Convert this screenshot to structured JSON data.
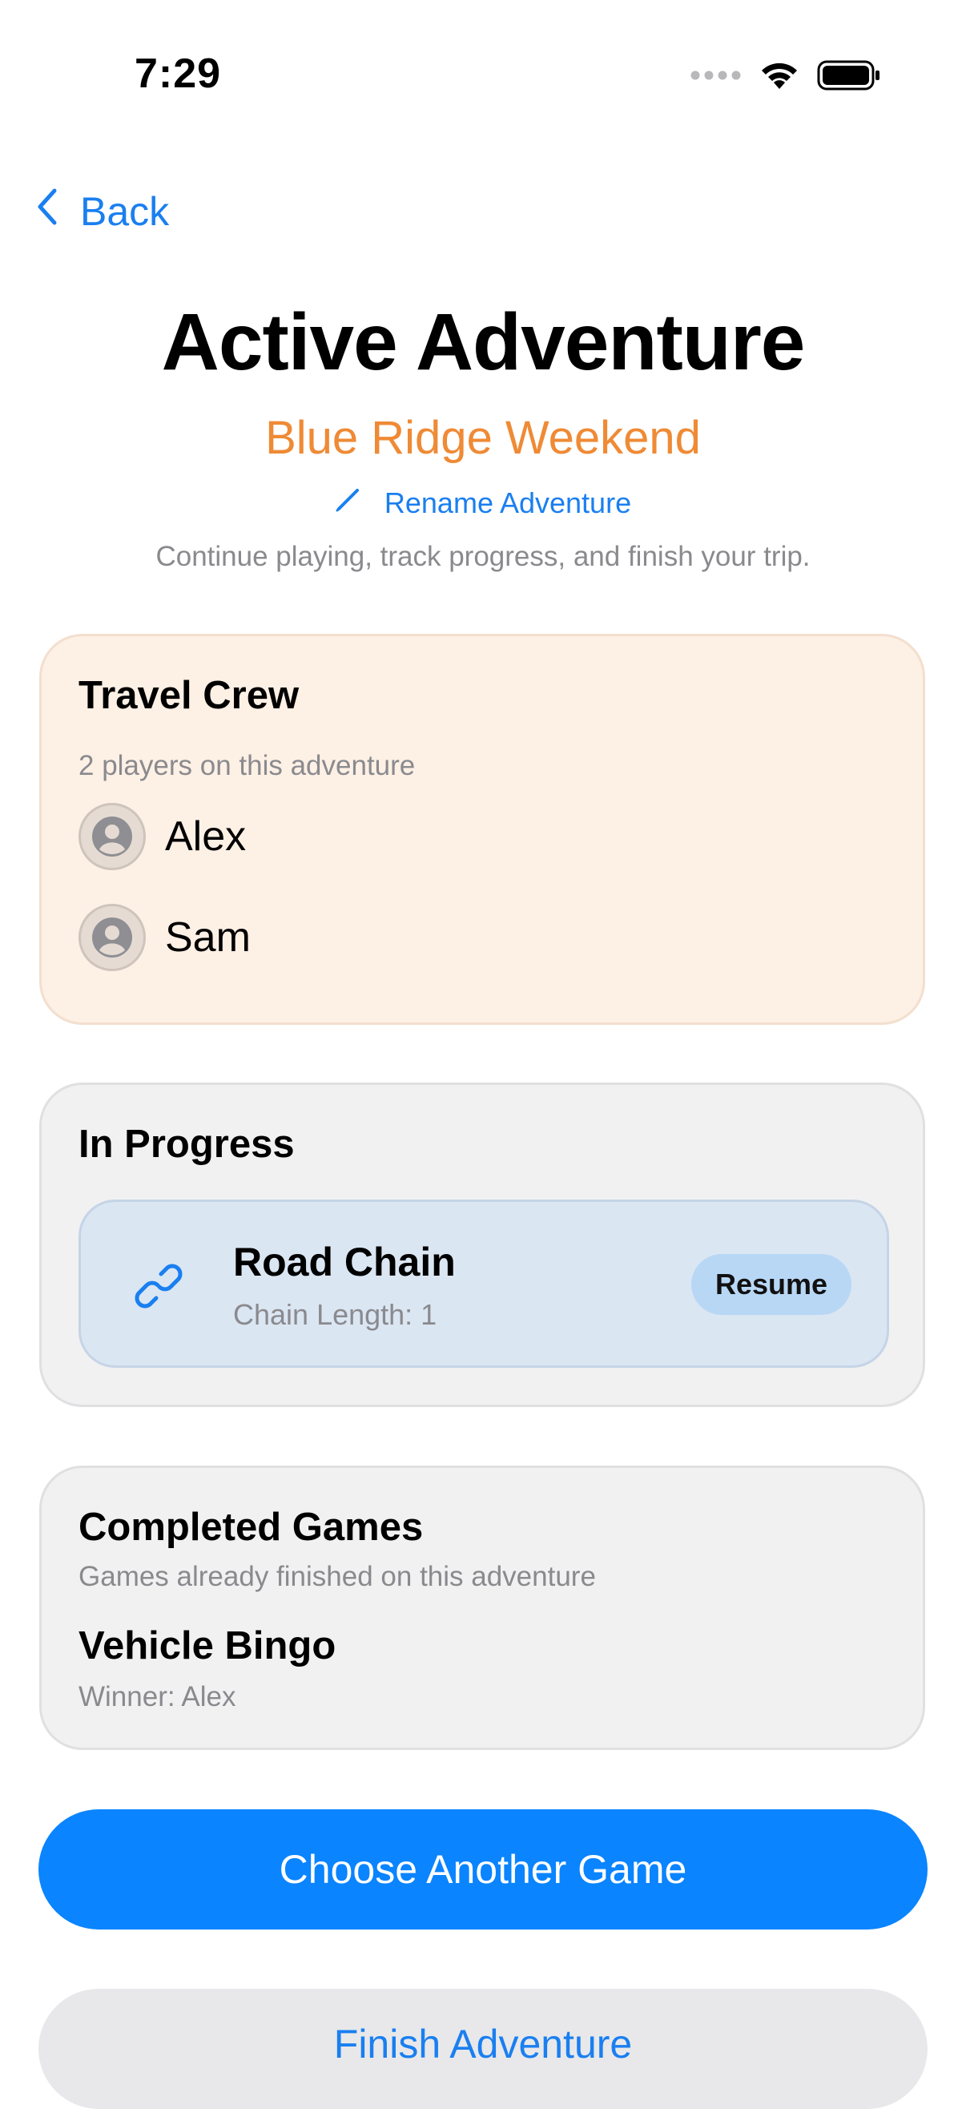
{
  "status_bar": {
    "time": "7:29",
    "icons": [
      "signal-dots-icon",
      "wifi-icon",
      "battery-icon"
    ]
  },
  "nav": {
    "back_label": "Back"
  },
  "header": {
    "title": "Active Adventure",
    "adventure_name": "Blue Ridge Weekend",
    "rename_label": "Rename Adventure",
    "description": "Continue playing, track progress, and finish your trip."
  },
  "crew": {
    "heading": "Travel Crew",
    "summary": "2 players on this adventure",
    "players": [
      {
        "name": "Alex"
      },
      {
        "name": "Sam"
      }
    ]
  },
  "in_progress": {
    "heading": "In Progress",
    "games": [
      {
        "name": "Road Chain",
        "meta": "Chain Length: 1",
        "action": "Resume",
        "icon": "link-icon"
      }
    ]
  },
  "completed": {
    "heading": "Completed Games",
    "subheading": "Games already finished on this adventure",
    "games": [
      {
        "name": "Vehicle Bingo",
        "result": "Winner: Alex"
      }
    ]
  },
  "actions": {
    "primary": "Choose Another Game",
    "secondary": "Finish Adventure"
  },
  "colors": {
    "accent": "#0a84ff",
    "link": "#1a7ff0",
    "adventure_name": "#ef8a35",
    "crew_card": "#fdf0e5",
    "card": "#f1f1f2",
    "game_row": "#dbe6f3",
    "resume_button": "#b8d7f5"
  }
}
